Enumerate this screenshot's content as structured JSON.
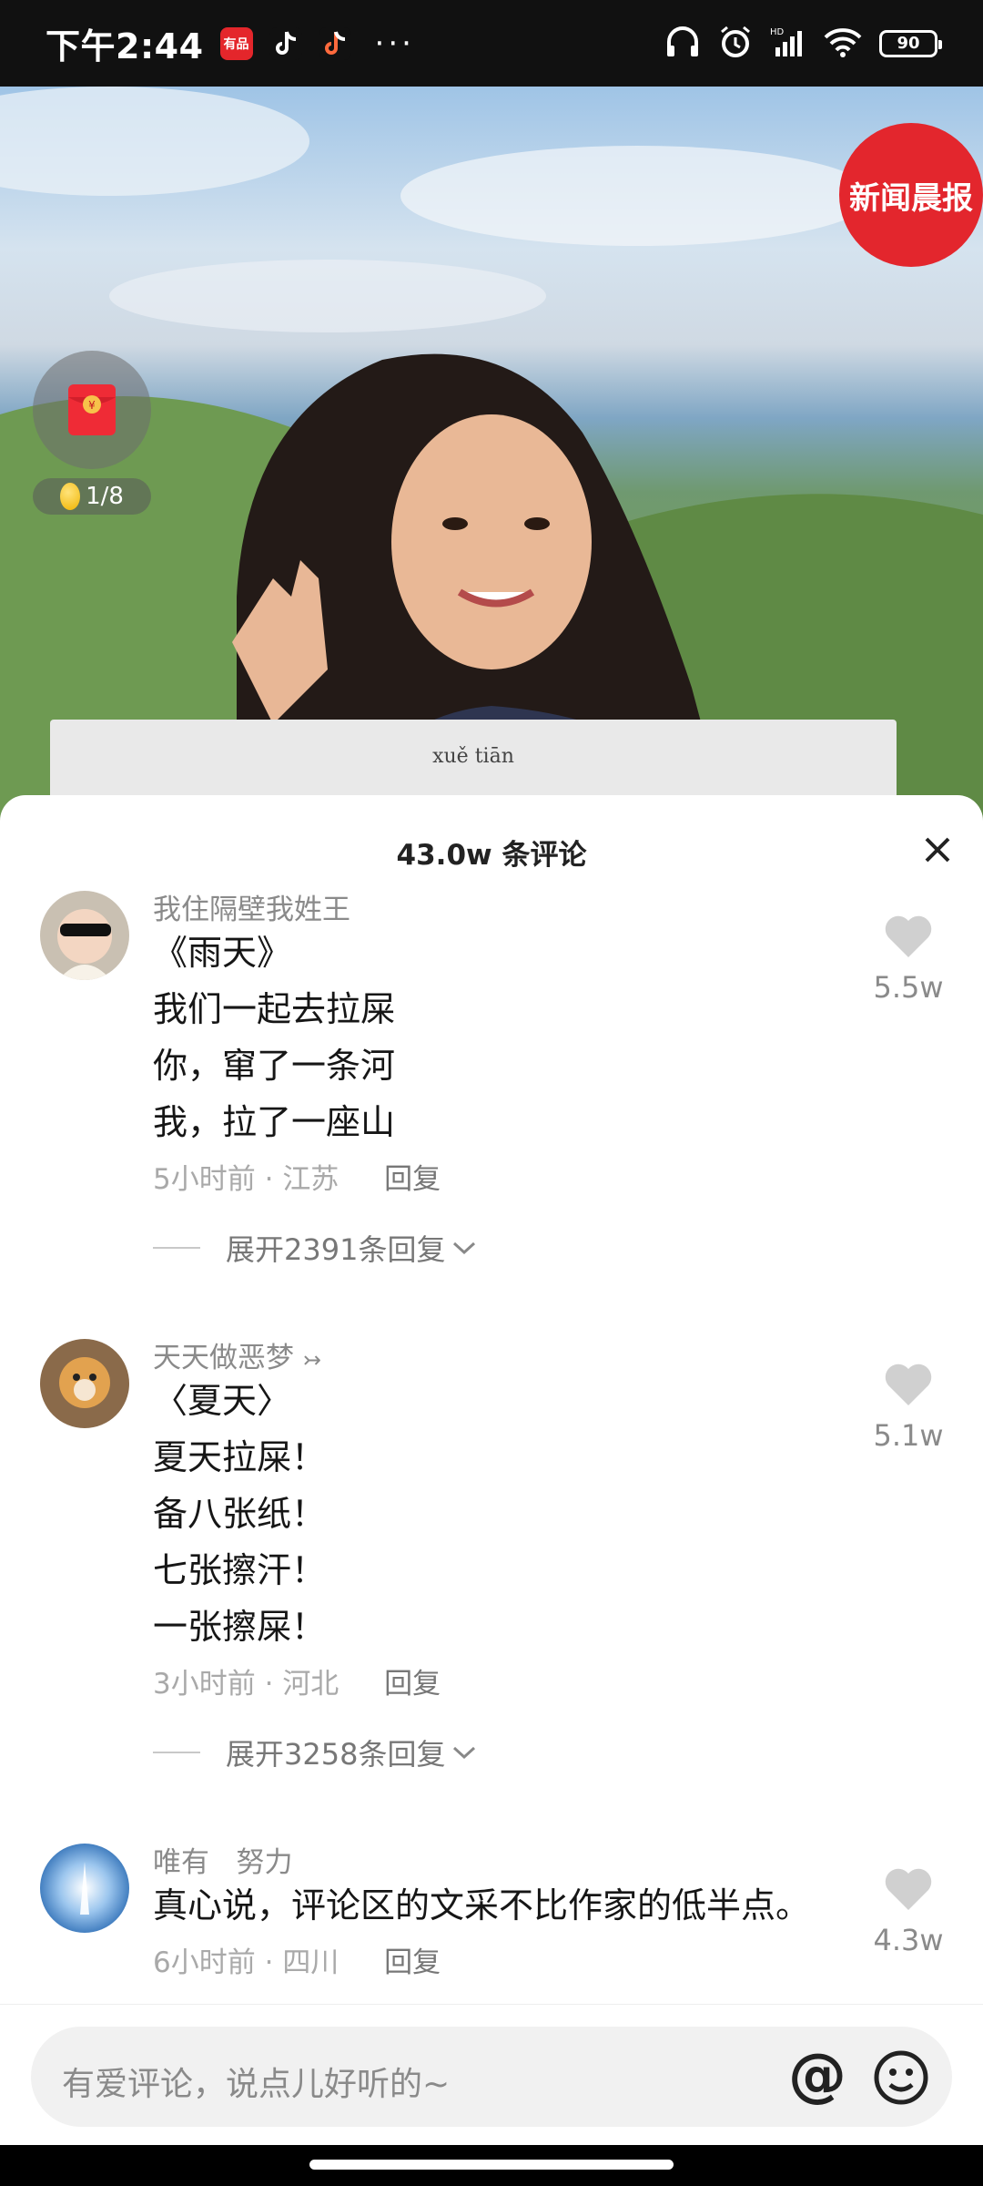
{
  "status_bar": {
    "time": "下午2:44",
    "app_badge_red": "有品",
    "more": "···",
    "battery": "90"
  },
  "video": {
    "logo_text": "新闻晨报",
    "paper_text": "xuě tiān",
    "coin_counter": "1/8"
  },
  "comments_header": {
    "title": "43.0w 条评论"
  },
  "comments": [
    {
      "user": "我住隔壁我姓王",
      "lines": [
        "《雨天》",
        "我们一起去拉屎",
        "你，窜了一条河",
        "我，拉了一座山"
      ],
      "time": "5小时前",
      "location": "江苏",
      "reply_label": "回复",
      "expand": "展开2391条回复",
      "likes": "5.5w"
    },
    {
      "user": "天天做恶梦",
      "user_suffix": "↣",
      "lines": [
        "〈夏天〉",
        "夏天拉屎！",
        "备八张纸！",
        "七张擦汗！",
        "一张擦屎！"
      ],
      "time": "3小时前",
      "location": "河北",
      "reply_label": "回复",
      "expand": "展开3258条回复",
      "likes": "5.1w"
    },
    {
      "user": "唯有   努力",
      "lines": [
        "真心说，评论区的文采不比作家的低半点。"
      ],
      "time": "6小时前",
      "location": "四川",
      "reply_label": "回复",
      "likes": "4.3w"
    }
  ],
  "input": {
    "placeholder": "有爱评论，说点儿好听的~",
    "at_symbol": "@"
  },
  "colors": {
    "accent_red": "#e3262d",
    "sheet_bg": "#ffffff",
    "muted_text": "#8a8a8a"
  }
}
